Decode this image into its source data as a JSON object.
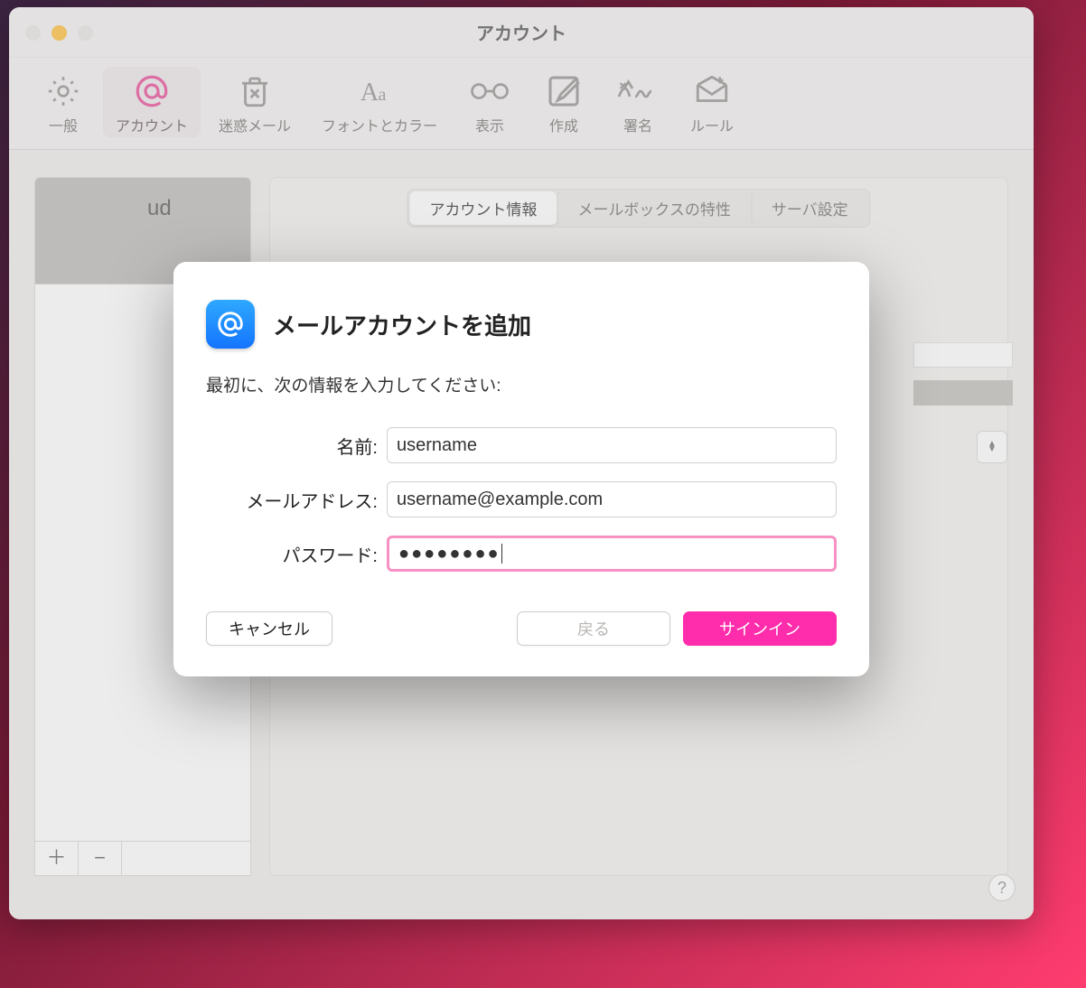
{
  "window": {
    "title": "アカウント"
  },
  "toolbar": {
    "general": "一般",
    "accounts": "アカウント",
    "junk": "迷惑メール",
    "fonts": "フォントとカラー",
    "viewing": "表示",
    "composing": "作成",
    "signatures": "署名",
    "rules": "ルール"
  },
  "sidebar": {
    "item0": "ud",
    "add": "＋",
    "remove": "−"
  },
  "segments": {
    "info": "アカウント情報",
    "mailbox": "メールボックスの特性",
    "server": "サーバ設定"
  },
  "modal": {
    "title": "メールアカウントを追加",
    "subtitle": "最初に、次の情報を入力してください:",
    "name_label": "名前:",
    "email_label": "メールアドレス:",
    "password_label": "パスワード:",
    "name_value": "username",
    "email_value": "username@example.com",
    "password_mask": "●●●●●●●●",
    "cancel": "キャンセル",
    "back": "戻る",
    "signin": "サインイン"
  },
  "help": "?"
}
